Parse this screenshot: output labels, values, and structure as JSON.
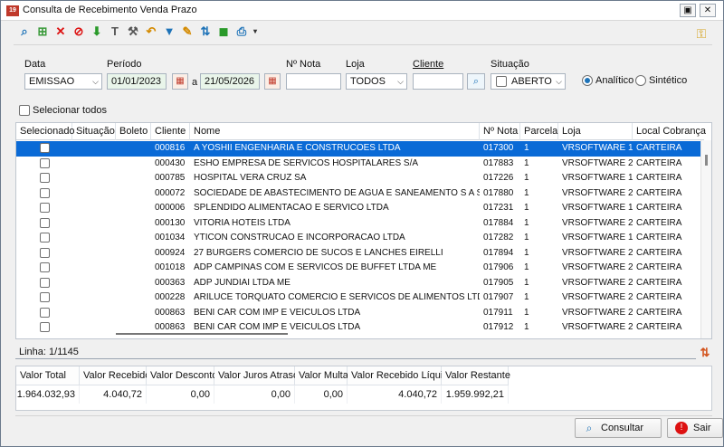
{
  "window": {
    "title": "Consulta de Recebimento Venda Prazo",
    "app_icon": "19"
  },
  "toolbar": {
    "icons": [
      "search-doc-icon",
      "new-doc-icon",
      "delete-icon",
      "cancel-icon",
      "download-icon",
      "hammer-icon",
      "wrench-icon",
      "undo-icon",
      "filter-icon",
      "edit-icon",
      "transfer-icon",
      "package-icon",
      "print-icon"
    ]
  },
  "filters": {
    "data_label": "Data",
    "data_value": "EMISSAO",
    "periodo_label": "Período",
    "date_from": "01/01/2023",
    "date_sep": "a",
    "date_to": "21/05/2026",
    "nota_label": "Nº Nota",
    "nota_value": "",
    "loja_label": "Loja",
    "loja_value": "TODOS",
    "cliente_label": "Cliente",
    "cliente_value": "",
    "situacao_label": "Situação",
    "situacao_value": "ABERTO",
    "analitico_label": "Analítico",
    "sintetico_label": "Sintético",
    "mode_selected": "Analítico"
  },
  "select_all_label": "Selecionar todos",
  "grid": {
    "columns": [
      "Selecionado",
      "Situação",
      "Boleto",
      "Cliente",
      "Nome",
      "Nº Nota",
      "Parcela",
      "Loja",
      "Local Cobrança"
    ],
    "rows": [
      {
        "cliente": "000816",
        "nome": "A YOSHII ENGENHARIA E CONSTRUCOES LTDA",
        "nota": "017300",
        "parcela": "1",
        "loja": "VRSOFTWARE 1",
        "local": "CARTEIRA"
      },
      {
        "cliente": "000430",
        "nome": "ESHO EMPRESA DE SERVICOS HOSPITALARES S/A",
        "nota": "017883",
        "parcela": "1",
        "loja": "VRSOFTWARE 2",
        "local": "CARTEIRA"
      },
      {
        "cliente": "000785",
        "nome": "HOSPITAL VERA CRUZ SA",
        "nota": "017226",
        "parcela": "1",
        "loja": "VRSOFTWARE 1",
        "local": "CARTEIRA"
      },
      {
        "cliente": "000072",
        "nome": "SOCIEDADE DE ABASTECIMENTO DE AGUA E SANEAMENTO S A SANASA",
        "nota": "017880",
        "parcela": "1",
        "loja": "VRSOFTWARE 2",
        "local": "CARTEIRA"
      },
      {
        "cliente": "000006",
        "nome": "SPLENDIDO ALIMENTACAO E SERVICO LTDA",
        "nota": "017231",
        "parcela": "1",
        "loja": "VRSOFTWARE 1",
        "local": "CARTEIRA"
      },
      {
        "cliente": "000130",
        "nome": "VITORIA HOTEIS LTDA",
        "nota": "017884",
        "parcela": "1",
        "loja": "VRSOFTWARE 2",
        "local": "CARTEIRA"
      },
      {
        "cliente": "001034",
        "nome": "YTICON CONSTRUCAO E INCORPORACAO LTDA",
        "nota": "017282",
        "parcela": "1",
        "loja": "VRSOFTWARE 1",
        "local": "CARTEIRA"
      },
      {
        "cliente": "000924",
        "nome": "27 BURGERS COMERCIO DE SUCOS E LANCHES EIRELLI",
        "nota": "017894",
        "parcela": "1",
        "loja": "VRSOFTWARE 2",
        "local": "CARTEIRA"
      },
      {
        "cliente": "001018",
        "nome": "ADP CAMPINAS COM E SERVICOS DE BUFFET LTDA ME",
        "nota": "017906",
        "parcela": "1",
        "loja": "VRSOFTWARE 2",
        "local": "CARTEIRA"
      },
      {
        "cliente": "000363",
        "nome": "ADP JUNDIAI LTDA ME",
        "nota": "017905",
        "parcela": "1",
        "loja": "VRSOFTWARE 2",
        "local": "CARTEIRA"
      },
      {
        "cliente": "000228",
        "nome": "ARILUCE TORQUATO COMERCIO E SERVICOS DE ALIMENTOS LTDA ME",
        "nota": "017907",
        "parcela": "1",
        "loja": "VRSOFTWARE 2",
        "local": "CARTEIRA"
      },
      {
        "cliente": "000863",
        "nome": "BENI CAR COM IMP E VEICULOS LTDA",
        "nota": "017911",
        "parcela": "1",
        "loja": "VRSOFTWARE 2",
        "local": "CARTEIRA"
      },
      {
        "cliente": "000863",
        "nome": "BENI CAR COM IMP E VEICULOS LTDA",
        "nota": "017912",
        "parcela": "1",
        "loja": "VRSOFTWARE 2",
        "local": "CARTEIRA"
      }
    ]
  },
  "status": {
    "linha": "Linha: 1/1145"
  },
  "totals": {
    "headers": [
      "Valor Total",
      "Valor Recebido",
      "Valor Desconto",
      "Valor Juros Atraso",
      "Valor Multa",
      "Valor Recebido Líquido",
      "Valor Restante"
    ],
    "values": [
      "1.964.032,93",
      "4.040,72",
      "0,00",
      "0,00",
      "0,00",
      "4.040,72",
      "1.959.992,21"
    ]
  },
  "buttons": {
    "consultar": "Consultar",
    "sair": "Sair"
  },
  "colors": {
    "selection": "#0a6ad6",
    "accent": "#1e73b8"
  }
}
